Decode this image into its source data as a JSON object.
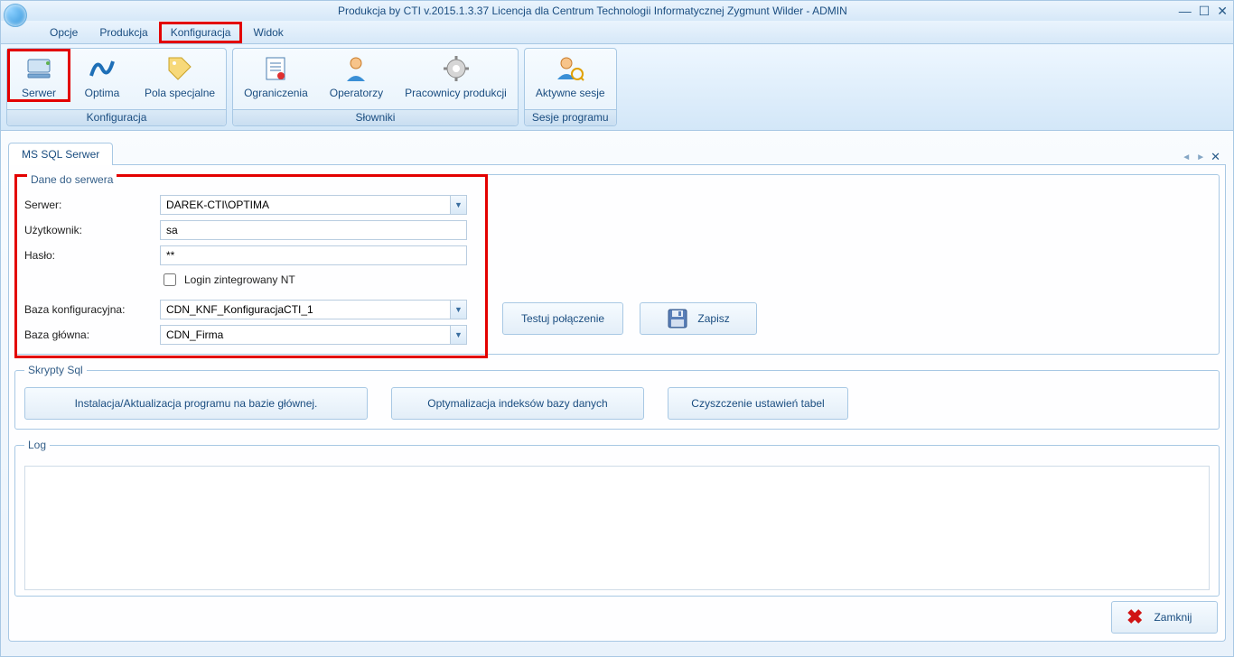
{
  "window": {
    "title": "Produkcja by CTI v.2015.1.3.37 Licencja dla Centrum Technologii Informatycznej Zygmunt Wilder - ADMIN"
  },
  "menu": {
    "items": [
      "Opcje",
      "Produkcja",
      "Konfiguracja",
      "Widok"
    ],
    "highlighted": "Konfiguracja"
  },
  "ribbon": {
    "groups": [
      {
        "label": "Konfiguracja",
        "items": [
          {
            "name": "serwer",
            "label": "Serwer",
            "icon": "server-icon",
            "hl": true
          },
          {
            "name": "optima",
            "label": "Optima",
            "icon": "optima-icon"
          },
          {
            "name": "pola",
            "label": "Pola specjalne",
            "icon": "tag-icon"
          }
        ]
      },
      {
        "label": "Słowniki",
        "items": [
          {
            "name": "ograniczenia",
            "label": "Ograniczenia",
            "icon": "list-icon"
          },
          {
            "name": "operatorzy",
            "label": "Operatorzy",
            "icon": "person-icon"
          },
          {
            "name": "pracownicy",
            "label": "Pracownicy produkcji",
            "icon": "gear-icon"
          }
        ]
      },
      {
        "label": "Sesje programu",
        "items": [
          {
            "name": "aktywne",
            "label": "Aktywne sesje",
            "icon": "session-icon"
          }
        ]
      }
    ]
  },
  "tab": {
    "label": "MS SQL Serwer"
  },
  "form": {
    "fieldset_dane": "Dane do serwera",
    "server_label": "Serwer:",
    "server_value": "DAREK-CTI\\OPTIMA",
    "user_label": "Użytkownik:",
    "user_value": "sa",
    "pass_label": "Hasło:",
    "pass_value": "**",
    "nt_label": "Login zintegrowany NT",
    "cfgdb_label": "Baza konfiguracyjna:",
    "cfgdb_value": "CDN_KNF_KonfiguracjaCTI_1",
    "maindb_label": "Baza główna:",
    "maindb_value": "CDN_Firma",
    "test_btn": "Testuj połączenie",
    "save_btn": "Zapisz",
    "fieldset_sql": "Skrypty Sql",
    "btn_install": "Instalacja/Aktualizacja programu na bazie głównej.",
    "btn_opt": "Optymalizacja indeksów bazy danych",
    "btn_clean": "Czyszczenie ustawień tabel",
    "fieldset_log": "Log",
    "close_btn": "Zamknij"
  }
}
